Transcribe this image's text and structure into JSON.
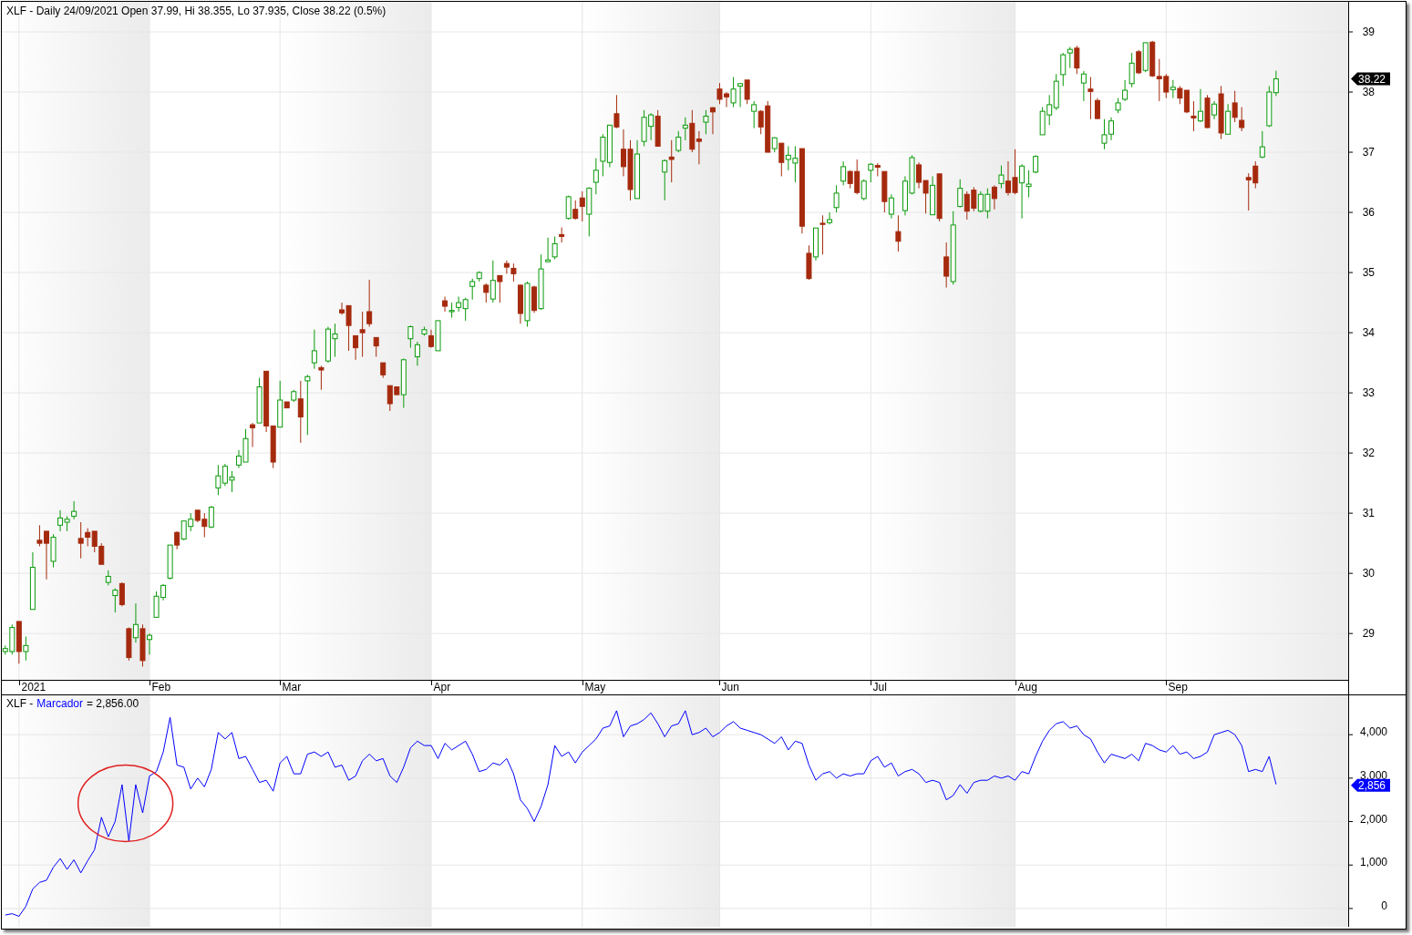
{
  "price_pane": {
    "header": "XLF - Daily 24/09/2021 Open 37.99, Hi 38.355, Lo 37.935, Close 38.22 (0.5%)",
    "chart_data": {
      "type": "candlestick",
      "grid": true,
      "ylim": [
        28.23,
        39.5
      ],
      "yticks": [
        {
          "value": 29,
          "label": "29"
        },
        {
          "value": 30,
          "label": "30"
        },
        {
          "value": 31,
          "label": "31"
        },
        {
          "value": 32,
          "label": "32"
        },
        {
          "value": 33,
          "label": "33"
        },
        {
          "value": 34,
          "label": "34"
        },
        {
          "value": 35,
          "label": "35"
        },
        {
          "value": 36,
          "label": "36"
        },
        {
          "value": 37,
          "label": "37"
        },
        {
          "value": 38,
          "label": "38"
        },
        {
          "value": 39,
          "label": "39"
        }
      ],
      "ohlc": [
        [
          28.7,
          28.8,
          28.65,
          28.75
        ],
        [
          28.7,
          29.15,
          28.65,
          29.1
        ],
        [
          29.2,
          29.2,
          28.5,
          28.7
        ],
        [
          28.7,
          28.95,
          28.55,
          28.8
        ],
        [
          29.4,
          30.35,
          29.4,
          30.1
        ],
        [
          30.55,
          30.8,
          30.45,
          30.5
        ],
        [
          30.7,
          30.7,
          29.9,
          30.5
        ],
        [
          30.2,
          30.65,
          30.1,
          30.6
        ],
        [
          30.8,
          31.05,
          30.7,
          30.92
        ],
        [
          30.85,
          30.95,
          30.7,
          30.9
        ],
        [
          30.95,
          31.2,
          30.9,
          31.03
        ],
        [
          30.58,
          30.85,
          30.25,
          30.5
        ],
        [
          30.68,
          30.75,
          30.45,
          30.6
        ],
        [
          30.7,
          30.7,
          30.35,
          30.45
        ],
        [
          30.45,
          30.5,
          30.15,
          30.15
        ],
        [
          29.85,
          30.05,
          29.8,
          29.95
        ],
        [
          29.63,
          29.75,
          29.35,
          29.72
        ],
        [
          29.83,
          29.85,
          29.45,
          29.48
        ],
        [
          29.08,
          29.1,
          28.55,
          28.6
        ],
        [
          28.93,
          29.5,
          28.85,
          29.15
        ],
        [
          29.08,
          29.15,
          28.45,
          28.55
        ],
        [
          28.9,
          29.0,
          28.65,
          28.97
        ],
        [
          29.27,
          29.7,
          29.27,
          29.62
        ],
        [
          29.6,
          29.82,
          29.55,
          29.8
        ],
        [
          29.92,
          30.47,
          29.9,
          30.47
        ],
        [
          30.68,
          30.7,
          30.4,
          30.47
        ],
        [
          30.57,
          30.87,
          30.55,
          30.87
        ],
        [
          30.78,
          31.0,
          30.7,
          30.9
        ],
        [
          31.05,
          31.05,
          30.85,
          30.88
        ],
        [
          30.9,
          31.0,
          30.6,
          30.78
        ],
        [
          30.77,
          31.12,
          30.75,
          31.1
        ],
        [
          31.42,
          31.8,
          31.3,
          31.62
        ],
        [
          31.5,
          31.82,
          31.45,
          31.78
        ],
        [
          31.55,
          31.7,
          31.35,
          31.6
        ],
        [
          31.8,
          32.05,
          31.75,
          31.95
        ],
        [
          31.85,
          32.4,
          31.85,
          32.24
        ],
        [
          32.47,
          32.5,
          32.1,
          32.42
        ],
        [
          32.5,
          33.25,
          32.5,
          33.1
        ],
        [
          33.36,
          33.36,
          32.35,
          32.45
        ],
        [
          32.45,
          32.45,
          31.75,
          31.85
        ],
        [
          32.43,
          33.2,
          32.43,
          32.88
        ],
        [
          32.85,
          32.85,
          32.75,
          32.75
        ],
        [
          32.88,
          33.05,
          32.85,
          33.02
        ],
        [
          32.9,
          33.2,
          32.17,
          32.6
        ],
        [
          33.2,
          33.3,
          32.3,
          33.27
        ],
        [
          33.5,
          34.05,
          33.4,
          33.7
        ],
        [
          33.42,
          33.45,
          33.05,
          33.38
        ],
        [
          33.53,
          34.1,
          33.5,
          34.06
        ],
        [
          33.9,
          34.15,
          33.6,
          33.98
        ],
        [
          34.38,
          34.5,
          34.3,
          34.33
        ],
        [
          34.45,
          34.45,
          33.7,
          34.12
        ],
        [
          33.95,
          33.95,
          33.55,
          33.75
        ],
        [
          34.05,
          34.35,
          33.6,
          34.0
        ],
        [
          34.35,
          34.88,
          34.1,
          34.15
        ],
        [
          33.92,
          33.92,
          33.6,
          33.78
        ],
        [
          33.5,
          33.5,
          33.25,
          33.3
        ],
        [
          33.12,
          33.12,
          32.7,
          32.82
        ],
        [
          33.1,
          33.1,
          32.97,
          32.97
        ],
        [
          32.97,
          33.57,
          32.75,
          33.55
        ],
        [
          33.9,
          34.12,
          33.75,
          34.1
        ],
        [
          33.6,
          33.85,
          33.45,
          33.8
        ],
        [
          33.98,
          34.1,
          33.95,
          34.05
        ],
        [
          33.95,
          34.05,
          33.75,
          33.77
        ],
        [
          33.7,
          34.2,
          33.7,
          34.2
        ],
        [
          34.53,
          34.6,
          34.35,
          34.44
        ],
        [
          34.35,
          34.5,
          34.25,
          34.37
        ],
        [
          34.42,
          34.6,
          34.35,
          34.5
        ],
        [
          34.4,
          34.58,
          34.2,
          34.55
        ],
        [
          34.77,
          34.9,
          34.55,
          34.85
        ],
        [
          34.9,
          35.02,
          34.85,
          35.0
        ],
        [
          34.79,
          34.82,
          34.5,
          34.67
        ],
        [
          34.56,
          35.2,
          34.5,
          34.87
        ],
        [
          34.95,
          34.95,
          34.5,
          34.85
        ],
        [
          35.15,
          35.2,
          34.98,
          35.09
        ],
        [
          35.07,
          35.15,
          34.85,
          34.98
        ],
        [
          34.79,
          34.8,
          34.15,
          34.32
        ],
        [
          34.2,
          34.85,
          34.1,
          34.82
        ],
        [
          34.76,
          34.78,
          34.33,
          34.37
        ],
        [
          34.4,
          35.3,
          34.38,
          35.06
        ],
        [
          35.18,
          35.58,
          35.18,
          35.21
        ],
        [
          35.26,
          35.6,
          35.22,
          35.48
        ],
        [
          35.63,
          35.75,
          35.5,
          35.6
        ],
        [
          35.9,
          36.28,
          35.88,
          36.26
        ],
        [
          36.05,
          36.2,
          35.88,
          35.9
        ],
        [
          36.24,
          36.35,
          35.85,
          36.1
        ],
        [
          35.97,
          36.42,
          35.6,
          36.4
        ],
        [
          36.5,
          36.9,
          36.3,
          36.7
        ],
        [
          36.85,
          37.3,
          36.6,
          37.25
        ],
        [
          36.83,
          37.45,
          36.75,
          37.45
        ],
        [
          37.64,
          37.95,
          37.4,
          37.42
        ],
        [
          37.05,
          37.38,
          36.6,
          36.76
        ],
        [
          37.05,
          37.2,
          36.2,
          36.38
        ],
        [
          36.23,
          37.2,
          36.23,
          36.97
        ],
        [
          37.18,
          37.7,
          37.1,
          37.58
        ],
        [
          37.43,
          37.65,
          37.2,
          37.62
        ],
        [
          37.6,
          37.7,
          37.1,
          37.1
        ],
        [
          36.67,
          36.88,
          36.2,
          36.86
        ],
        [
          36.92,
          37.2,
          36.5,
          36.88
        ],
        [
          37.03,
          37.35,
          37.0,
          37.25
        ],
        [
          37.4,
          37.58,
          37.2,
          37.45
        ],
        [
          37.48,
          37.7,
          37.0,
          37.05
        ],
        [
          37.22,
          37.35,
          36.8,
          37.18
        ],
        [
          37.5,
          37.7,
          37.3,
          37.6
        ],
        [
          37.74,
          37.75,
          37.3,
          37.67
        ],
        [
          38.05,
          38.15,
          37.8,
          37.88
        ],
        [
          37.97,
          38.0,
          37.75,
          37.92
        ],
        [
          37.82,
          38.25,
          37.75,
          38.05
        ],
        [
          38.1,
          38.15,
          37.75,
          38.14
        ],
        [
          38.2,
          38.2,
          37.8,
          37.88
        ],
        [
          37.68,
          37.85,
          37.4,
          37.79
        ],
        [
          37.68,
          37.7,
          37.3,
          37.42
        ],
        [
          37.77,
          37.85,
          37.0,
          37.0
        ],
        [
          37.06,
          37.25,
          37.0,
          37.24
        ],
        [
          37.15,
          37.15,
          36.6,
          36.83
        ],
        [
          36.88,
          37.1,
          36.7,
          36.95
        ],
        [
          36.82,
          37.1,
          36.5,
          36.9
        ],
        [
          37.06,
          37.06,
          35.65,
          35.77
        ],
        [
          35.32,
          35.45,
          34.88,
          34.9
        ],
        [
          35.26,
          35.74,
          35.2,
          35.74
        ],
        [
          35.82,
          35.95,
          35.3,
          35.8
        ],
        [
          35.83,
          36.0,
          35.8,
          35.88
        ],
        [
          36.08,
          36.45,
          36.0,
          36.32
        ],
        [
          36.52,
          36.85,
          36.45,
          36.76
        ],
        [
          36.68,
          36.7,
          36.4,
          36.48
        ],
        [
          36.68,
          36.88,
          36.3,
          36.33
        ],
        [
          36.23,
          36.55,
          36.2,
          36.52
        ],
        [
          36.7,
          36.82,
          36.5,
          36.8
        ],
        [
          36.78,
          36.82,
          36.6,
          36.75
        ],
        [
          36.68,
          36.68,
          36.0,
          36.18
        ],
        [
          35.97,
          36.3,
          35.9,
          36.24
        ],
        [
          35.68,
          35.95,
          35.35,
          35.52
        ],
        [
          36.03,
          36.6,
          35.95,
          36.52
        ],
        [
          36.32,
          36.95,
          36.3,
          36.91
        ],
        [
          36.79,
          36.83,
          36.4,
          36.5
        ],
        [
          36.53,
          36.53,
          35.98,
          36.32
        ],
        [
          35.96,
          36.6,
          35.96,
          36.45
        ],
        [
          36.64,
          36.64,
          35.85,
          35.9
        ],
        [
          35.26,
          35.5,
          34.75,
          34.94
        ],
        [
          34.85,
          36.02,
          34.8,
          35.79
        ],
        [
          36.1,
          36.55,
          36.08,
          36.4
        ],
        [
          36.3,
          36.35,
          35.88,
          36.02
        ],
        [
          36.37,
          36.42,
          36.02,
          36.07
        ],
        [
          36.02,
          36.35,
          36.0,
          36.3
        ],
        [
          36.02,
          36.4,
          35.9,
          36.3
        ],
        [
          36.42,
          36.45,
          36.05,
          36.23
        ],
        [
          36.48,
          36.78,
          36.4,
          36.62
        ],
        [
          36.52,
          36.85,
          36.28,
          36.33
        ],
        [
          36.58,
          37.05,
          36.3,
          36.33
        ],
        [
          36.49,
          36.8,
          35.9,
          36.77
        ],
        [
          36.43,
          36.7,
          36.25,
          36.47
        ],
        [
          36.67,
          36.95,
          36.65,
          36.93
        ],
        [
          37.29,
          37.75,
          37.29,
          37.68
        ],
        [
          37.62,
          37.95,
          37.45,
          37.79
        ],
        [
          37.74,
          38.3,
          37.7,
          38.18
        ],
        [
          38.29,
          38.65,
          38.1,
          38.62
        ],
        [
          38.65,
          38.75,
          38.4,
          38.71
        ],
        [
          38.73,
          38.77,
          38.3,
          38.4
        ],
        [
          38.15,
          38.35,
          37.85,
          38.3
        ],
        [
          38.05,
          38.25,
          37.55,
          38.01
        ],
        [
          37.86,
          37.9,
          37.55,
          37.56
        ],
        [
          37.15,
          37.55,
          37.05,
          37.29
        ],
        [
          37.3,
          37.58,
          37.2,
          37.52
        ],
        [
          37.7,
          37.9,
          37.65,
          37.82
        ],
        [
          37.88,
          38.2,
          37.85,
          38.03
        ],
        [
          38.14,
          38.65,
          38.08,
          38.48
        ],
        [
          38.67,
          38.7,
          38.3,
          38.32
        ],
        [
          38.36,
          38.82,
          38.33,
          38.82
        ],
        [
          38.83,
          38.85,
          38.25,
          38.27
        ],
        [
          38.26,
          38.55,
          37.85,
          38.22
        ],
        [
          38.26,
          38.3,
          37.9,
          38.0
        ],
        [
          38.04,
          38.2,
          37.9,
          38.08
        ],
        [
          38.06,
          38.1,
          37.8,
          37.9
        ],
        [
          38.03,
          38.03,
          37.65,
          37.67
        ],
        [
          37.6,
          37.85,
          37.35,
          37.57
        ],
        [
          37.52,
          38.05,
          37.5,
          37.68
        ],
        [
          37.9,
          37.95,
          37.4,
          37.41
        ],
        [
          37.62,
          37.85,
          37.55,
          37.8
        ],
        [
          37.97,
          38.1,
          37.22,
          37.32
        ],
        [
          37.3,
          37.8,
          37.3,
          37.68
        ],
        [
          37.82,
          38.02,
          37.5,
          37.58
        ],
        [
          37.53,
          37.75,
          37.35,
          37.41
        ],
        [
          36.58,
          36.65,
          36.03,
          36.54
        ],
        [
          36.77,
          36.85,
          36.4,
          36.49
        ],
        [
          36.92,
          37.35,
          36.9,
          37.09
        ],
        [
          37.44,
          38.1,
          37.42,
          38.0
        ],
        [
          37.99,
          38.355,
          37.935,
          38.22
        ],
        null,
        null,
        null,
        null,
        null,
        null,
        null,
        null,
        null,
        null
      ],
      "annotations": [
        "38.22"
      ]
    },
    "date_axis": [
      "2021",
      "Feb",
      "Mar",
      "Apr",
      "May",
      "Jun",
      "Jul",
      "Aug",
      "Sep"
    ]
  },
  "indicator_pane": {
    "legend": {
      "symbol": "XLF -",
      "reading": "= 2,856.00"
    },
    "chart_data": {
      "type": "line",
      "grid": true,
      "ylim": [
        -421,
        4905
      ],
      "yticks": [
        {
          "value": 0,
          "label": "0"
        },
        {
          "value": 1000,
          "label": "1,000"
        },
        {
          "value": 2000,
          "label": "2,000"
        },
        {
          "value": 3000,
          "label": "3,000"
        },
        {
          "value": 4000,
          "label": "4,000"
        }
      ],
      "series": [
        {
          "name": "Marcador",
          "color": "#0000ff",
          "values": [
            -150,
            -120,
            -180,
            50,
            450,
            600,
            650,
            950,
            1150,
            900,
            1120,
            820,
            1100,
            1350,
            2100,
            1650,
            2000,
            2850,
            1550,
            2850,
            2200,
            3050,
            3150,
            3600,
            4400,
            3300,
            3250,
            2750,
            3000,
            2800,
            3200,
            4050,
            3900,
            4050,
            3450,
            3500,
            3200,
            2900,
            2950,
            2700,
            3350,
            3500,
            3100,
            3100,
            3550,
            3600,
            3500,
            3600,
            3250,
            3300,
            2950,
            3050,
            3400,
            3550,
            3400,
            3450,
            3050,
            2900,
            3250,
            3700,
            3850,
            3750,
            3750,
            3450,
            3800,
            3650,
            3750,
            3850,
            3550,
            3150,
            3200,
            3350,
            3300,
            3450,
            3100,
            2500,
            2300,
            2000,
            2350,
            2850,
            3750,
            3500,
            3600,
            3350,
            3600,
            3750,
            3900,
            4150,
            4200,
            4550,
            3950,
            4200,
            4250,
            4350,
            4500,
            4250,
            3950,
            4200,
            4250,
            4550,
            4000,
            4050,
            4150,
            3950,
            4050,
            4200,
            4300,
            4150,
            4100,
            4050,
            4000,
            3900,
            3800,
            3950,
            3650,
            3850,
            3800,
            3300,
            2950,
            3100,
            3150,
            3000,
            3100,
            3050,
            3100,
            3100,
            3400,
            3500,
            3250,
            3350,
            3050,
            3150,
            3200,
            3100,
            2900,
            2950,
            2900,
            2500,
            2600,
            2850,
            2650,
            2900,
            2950,
            2950,
            3050,
            3000,
            3050,
            2950,
            3150,
            3100,
            3500,
            3850,
            4100,
            4250,
            4300,
            4150,
            4200,
            4000,
            3900,
            3600,
            3350,
            3550,
            3500,
            3450,
            3550,
            3400,
            3800,
            3750,
            3650,
            3600,
            3750,
            3550,
            3600,
            3450,
            3500,
            3600,
            4000,
            4050,
            4100,
            4000,
            3750,
            3150,
            3200,
            3150,
            3500,
            2856,
            null,
            null,
            null,
            null,
            null,
            null,
            null,
            null,
            null,
            null
          ]
        }
      ],
      "annotations": [
        "2,856"
      ]
    }
  }
}
